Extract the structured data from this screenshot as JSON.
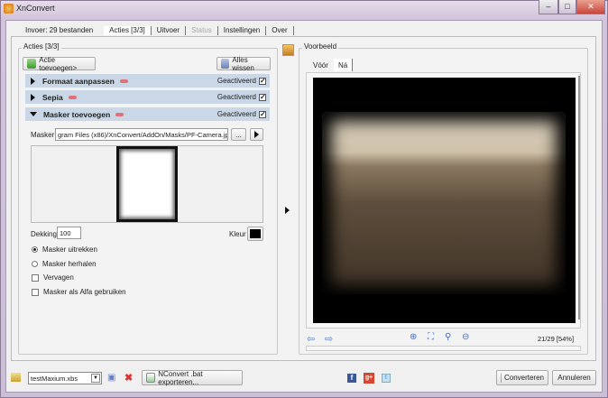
{
  "window": {
    "title": "XnConvert"
  },
  "tabs": [
    {
      "label": "Invoer: 29 bestanden"
    },
    {
      "label": "Acties [3/3]"
    },
    {
      "label": "Uitvoer"
    },
    {
      "label": "Status"
    },
    {
      "label": "Instellingen"
    },
    {
      "label": "Over"
    }
  ],
  "actions": {
    "group_title": "Acties [3/3]",
    "add_label": "Actie toevoegen>",
    "clear_label": "Alles wissen",
    "items": [
      {
        "name": "Formaat aanpassen",
        "state": "Geactiveerd",
        "checked": true
      },
      {
        "name": "Sepia",
        "state": "Geactiveerd",
        "checked": true
      },
      {
        "name": "Masker toevoegen",
        "state": "Geactiveerd",
        "checked": true
      }
    ],
    "mask": {
      "label": "Masker",
      "path": "gram Files (x86)/XnConvert/AddOn/Masks/PF-Camera.jpg",
      "browse_label": "...",
      "opacity_label": "Dekking",
      "opacity": "100",
      "color_label": "Kleur",
      "color": "#000000",
      "options": [
        {
          "label": "Masker uitrekken",
          "type": "radio",
          "checked": true
        },
        {
          "label": "Masker herhalen",
          "type": "radio",
          "checked": false
        },
        {
          "label": "Vervagen",
          "type": "checkbox",
          "checked": false
        },
        {
          "label": "Masker als Alfa gebruiken",
          "type": "checkbox",
          "checked": false
        }
      ]
    }
  },
  "preview": {
    "group_title": "Voorbeeld",
    "tabs": [
      {
        "label": "Vóór"
      },
      {
        "label": "Ná"
      }
    ],
    "counter": "21/29 [54%]"
  },
  "footer": {
    "preset": "testMaxium.xbs",
    "export_label": "NConvert .bat exporteren...",
    "convert_label": "Converteren",
    "cancel_label": "Annuleren"
  }
}
